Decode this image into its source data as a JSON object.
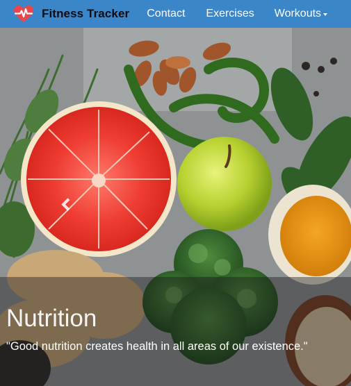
{
  "navbar": {
    "brand": {
      "logo_icon": "heartbeat-icon",
      "title": "Fitness Tracker"
    },
    "links": [
      {
        "label": "Contact"
      },
      {
        "label": "Exercises"
      },
      {
        "label": "Workouts",
        "has_dropdown": true
      }
    ],
    "colors": {
      "background": "#3a86c8",
      "brand_text": "#0c0c14",
      "link_text": "#ffffff"
    }
  },
  "carousel": {
    "image_subject": "healthy-food-photo",
    "prev_icon": "chevron-left-icon",
    "caption": {
      "title": "Nutrition",
      "quote": "\"Good nutrition creates health in all areas of our existence.\""
    }
  }
}
